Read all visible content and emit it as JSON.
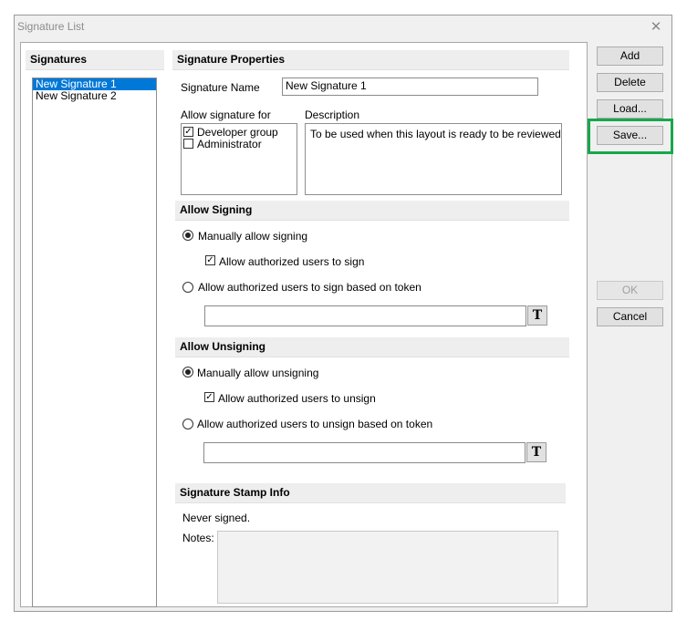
{
  "window": {
    "title": "Signature List",
    "close_glyph": "✕"
  },
  "signatures": {
    "header": "Signatures",
    "items": [
      "New Signature 1",
      "New Signature 2"
    ],
    "selected_index": 0
  },
  "properties": {
    "header": "Signature Properties",
    "name_label": "Signature Name",
    "name_value": "New Signature 1",
    "allow_label": "Allow signature for",
    "allow_items": [
      {
        "label": "Developer group",
        "checked": true
      },
      {
        "label": "Administrator",
        "checked": false
      }
    ],
    "description_label": "Description",
    "description_value": "To be used when this layout is ready to be reviewed"
  },
  "signing": {
    "header": "Allow Signing",
    "manual_label": "Manually allow signing",
    "manual_selected": true,
    "authorized_label": "Allow authorized users to sign",
    "authorized_checked": true,
    "token_label": "Allow authorized users to sign based on token",
    "token_selected": false,
    "token_value": "",
    "token_button_glyph": "T"
  },
  "unsigning": {
    "header": "Allow Unsigning",
    "manual_label": "Manually allow unsigning",
    "manual_selected": true,
    "authorized_label": "Allow authorized users to unsign",
    "authorized_checked": true,
    "token_label": "Allow authorized users to unsign based on token",
    "token_selected": false,
    "token_value": "",
    "token_button_glyph": "T"
  },
  "stamp": {
    "header": "Signature Stamp Info",
    "status": "Never signed.",
    "notes_label": "Notes:",
    "notes_value": ""
  },
  "buttons": {
    "add": "Add",
    "delete": "Delete",
    "load": "Load...",
    "save": "Save...",
    "ok": "OK",
    "cancel": "Cancel"
  },
  "colors": {
    "selection": "#0078d7",
    "highlight": "#17a84b"
  }
}
